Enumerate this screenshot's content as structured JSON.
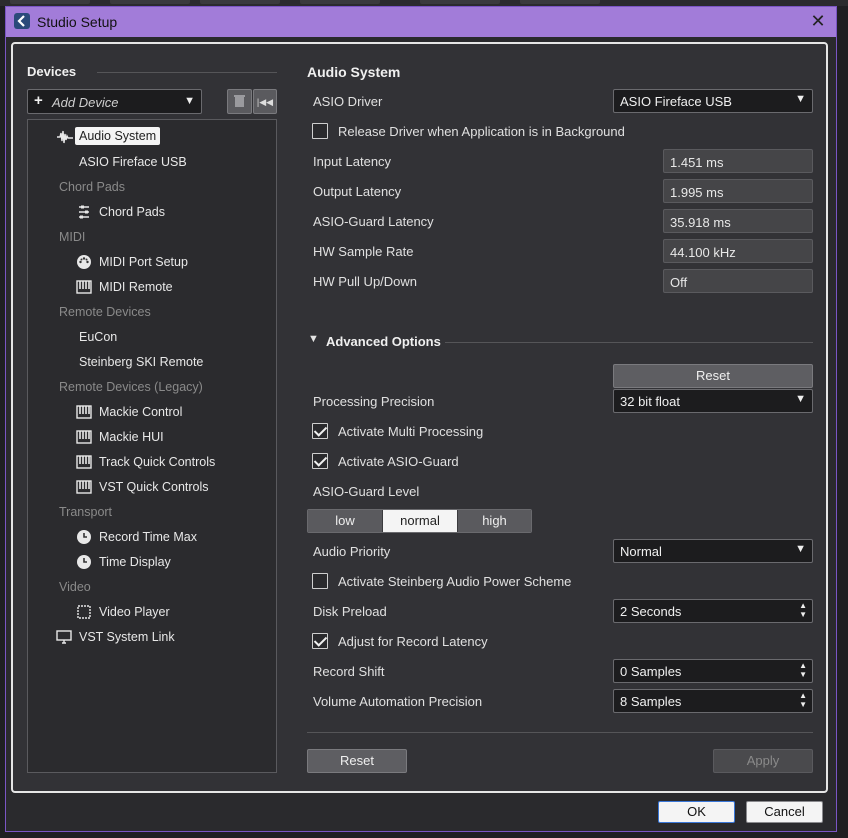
{
  "window": {
    "title": "Studio Setup"
  },
  "devices": {
    "heading": "Devices",
    "add_device_label": "Add Device",
    "tree": [
      {
        "kind": "item",
        "label": "Audio System",
        "icon": "audio-wave-icon",
        "selected": true,
        "indent": 1
      },
      {
        "kind": "item",
        "label": "ASIO Fireface USB",
        "icon": "",
        "indent": 2
      },
      {
        "kind": "cat",
        "label": "Chord Pads"
      },
      {
        "kind": "item",
        "label": "Chord Pads",
        "icon": "sliders-icon",
        "indent": 2
      },
      {
        "kind": "cat",
        "label": "MIDI"
      },
      {
        "kind": "item",
        "label": "MIDI Port Setup",
        "icon": "midi-port-icon",
        "indent": 2
      },
      {
        "kind": "item",
        "label": "MIDI Remote",
        "icon": "keyboard-icon",
        "indent": 2
      },
      {
        "kind": "cat",
        "label": "Remote Devices"
      },
      {
        "kind": "item",
        "label": "EuCon",
        "icon": "",
        "indent": 2
      },
      {
        "kind": "item",
        "label": "Steinberg SKI Remote",
        "icon": "",
        "indent": 2
      },
      {
        "kind": "cat",
        "label": "Remote Devices (Legacy)"
      },
      {
        "kind": "item",
        "label": "Mackie Control",
        "icon": "keyboard-icon",
        "indent": 2
      },
      {
        "kind": "item",
        "label": "Mackie HUI",
        "icon": "keyboard-icon",
        "indent": 2
      },
      {
        "kind": "item",
        "label": "Track Quick Controls",
        "icon": "keyboard-icon",
        "indent": 2
      },
      {
        "kind": "item",
        "label": "VST Quick Controls",
        "icon": "keyboard-icon",
        "indent": 2
      },
      {
        "kind": "cat",
        "label": "Transport"
      },
      {
        "kind": "item",
        "label": "Record Time Max",
        "icon": "clock-icon",
        "indent": 2
      },
      {
        "kind": "item",
        "label": "Time Display",
        "icon": "clock-icon",
        "indent": 2
      },
      {
        "kind": "cat",
        "label": "Video"
      },
      {
        "kind": "item",
        "label": "Video Player",
        "icon": "video-frame-icon",
        "indent": 2
      },
      {
        "kind": "item",
        "label": "VST System Link",
        "icon": "monitor-icon",
        "indent": 1
      }
    ]
  },
  "audio_system": {
    "heading": "Audio System",
    "asio_driver_label": "ASIO Driver",
    "asio_driver_value": "ASIO Fireface USB",
    "release_driver_label": "Release Driver when Application is in Background",
    "release_driver_checked": false,
    "input_latency_label": "Input Latency",
    "input_latency_value": "1.451 ms",
    "output_latency_label": "Output Latency",
    "output_latency_value": "1.995 ms",
    "asio_guard_latency_label": "ASIO-Guard Latency",
    "asio_guard_latency_value": "35.918 ms",
    "hw_sample_rate_label": "HW Sample Rate",
    "hw_sample_rate_value": "44.100 kHz",
    "hw_pull_label": "HW Pull Up/Down",
    "hw_pull_value": "Off"
  },
  "advanced": {
    "heading": "Advanced Options",
    "reset_label": "Reset",
    "precision_label": "Processing Precision",
    "precision_value": "32 bit float",
    "multi_processing_label": "Activate Multi Processing",
    "multi_processing_checked": true,
    "asio_guard_label": "Activate ASIO-Guard",
    "asio_guard_checked": true,
    "asio_guard_level_label": "ASIO-Guard Level",
    "asio_guard_levels": [
      "low",
      "normal",
      "high"
    ],
    "asio_guard_level_selected": "normal",
    "audio_priority_label": "Audio Priority",
    "audio_priority_value": "Normal",
    "power_scheme_label": "Activate Steinberg Audio Power Scheme",
    "power_scheme_checked": false,
    "disk_preload_label": "Disk Preload",
    "disk_preload_value": "2 Seconds",
    "adjust_record_label": "Adjust for Record Latency",
    "adjust_record_checked": true,
    "record_shift_label": "Record Shift",
    "record_shift_value": "0 Samples",
    "volume_precision_label": "Volume Automation Precision",
    "volume_precision_value": "8 Samples"
  },
  "bottom": {
    "reset_label": "Reset",
    "apply_label": "Apply",
    "ok_label": "OK",
    "cancel_label": "Cancel"
  },
  "colors": {
    "titlebar": "#a27cd9",
    "panel": "#323236",
    "selection": "#f4f4f4"
  }
}
